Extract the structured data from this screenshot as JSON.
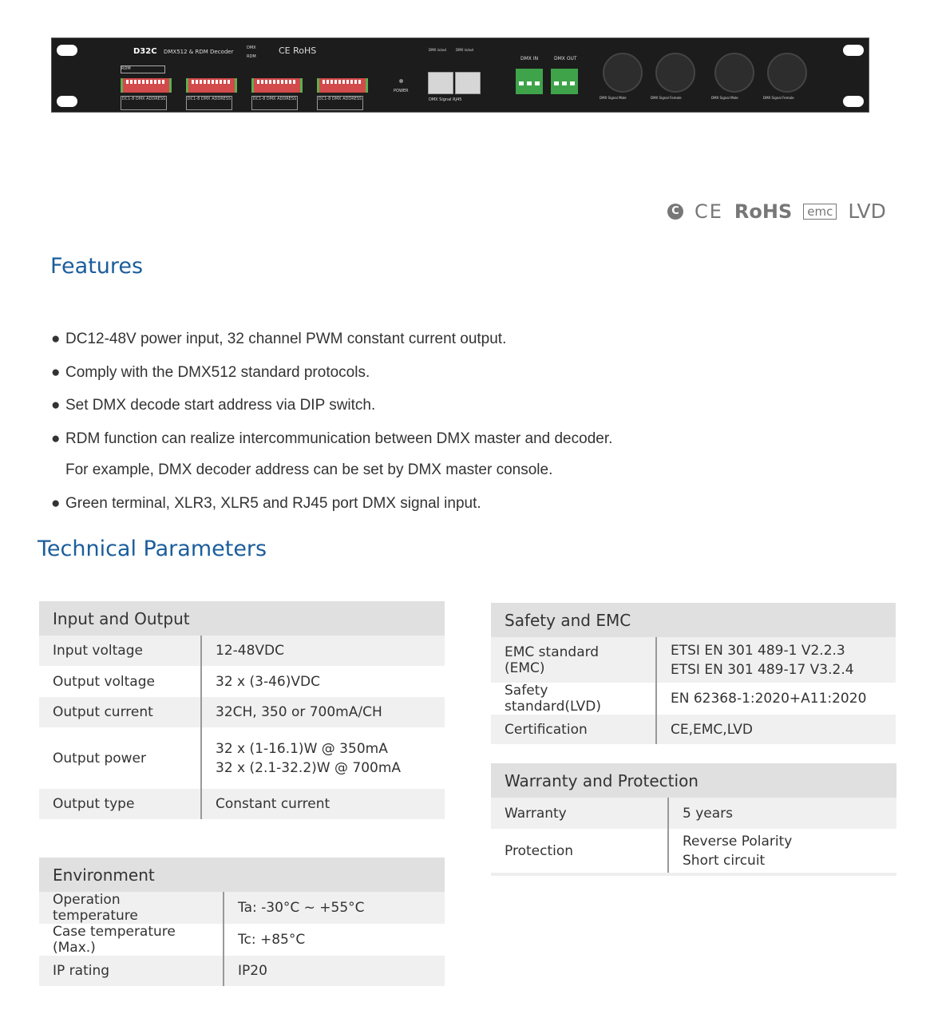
{
  "device": {
    "model": "D32C",
    "name": "DMX512 & RDM Decoder",
    "mode_labels": [
      "DMX",
      "RDM"
    ],
    "marks": "CE RoHS",
    "rdm_label": "RDM",
    "dip_labels": [
      "DC1-8 DMX ADDRESS",
      "DC1-8 DMX ADDRESS",
      "DC1-8 DMX ADDRESS",
      "DC1-8 DMX ADDRESS"
    ],
    "power_label": "POWER",
    "rj45_label": "DMX Signal RJ45",
    "rj45_port_label": "DMX in/out",
    "dmx_in": "DMX IN",
    "dmx_out": "DMX OUT",
    "xlr_labels": [
      "DMX Signal Male",
      "DMX Signal Female",
      "DMX Signal Male",
      "DMX Signal Female"
    ]
  },
  "certifications": {
    "c_tick": "C",
    "ce": "CE",
    "rohs": "RoHS",
    "emc": "emc",
    "lvd": "LVD"
  },
  "features": {
    "title": "Features",
    "items": [
      "DC12-48V power input, 32 channel PWM constant current output.",
      "Comply with the DMX512 standard protocols.",
      "Set DMX decode start address via DIP switch.",
      "RDM function can realize intercommunication between DMX master and decoder.",
      "Green terminal, XLR3, XLR5 and RJ45 port DMX signal input."
    ],
    "continuation": "For example, DMX decoder address can be set by DMX master console."
  },
  "tech": {
    "title": "Technical Parameters",
    "input_output": {
      "title": "Input and Output",
      "rows": [
        {
          "k": "Input voltage",
          "v": [
            "12-48VDC"
          ]
        },
        {
          "k": "Output voltage",
          "v": [
            "32 x (3-46)VDC"
          ]
        },
        {
          "k": "Output current",
          "v": [
            "32CH, 350 or 700mA/CH"
          ]
        },
        {
          "k": "Output power",
          "v": [
            "32 x (1-16.1)W    @ 350mA",
            "32 x (2.1-32.2)W @ 700mA"
          ]
        },
        {
          "k": "Output type",
          "v": [
            "Constant current"
          ]
        }
      ]
    },
    "environment": {
      "title": "Environment",
      "rows": [
        {
          "k": "Operation temperature",
          "v": [
            "Ta: -30°C ~ +55°C"
          ]
        },
        {
          "k": "Case temperature (Max.)",
          "v": [
            "Tc: +85°C"
          ]
        },
        {
          "k": "IP rating",
          "v": [
            "IP20"
          ]
        }
      ]
    },
    "safety_emc": {
      "title": "Safety and EMC",
      "rows": [
        {
          "k": "EMC standard (EMC)",
          "v": [
            "ETSI EN 301 489-1 V2.2.3",
            "ETSI EN 301 489-17 V3.2.4"
          ]
        },
        {
          "k": "Safety standard(LVD)",
          "v": [
            "EN 62368-1:2020+A11:2020"
          ]
        },
        {
          "k": "Certification",
          "v": [
            "CE,EMC,LVD"
          ]
        }
      ]
    },
    "warranty": {
      "title": "Warranty and Protection",
      "rows": [
        {
          "k": "Warranty",
          "v": [
            "5 years"
          ]
        },
        {
          "k": "Protection",
          "v": [
            "Reverse Polarity",
            "Short circuit"
          ]
        }
      ]
    }
  }
}
